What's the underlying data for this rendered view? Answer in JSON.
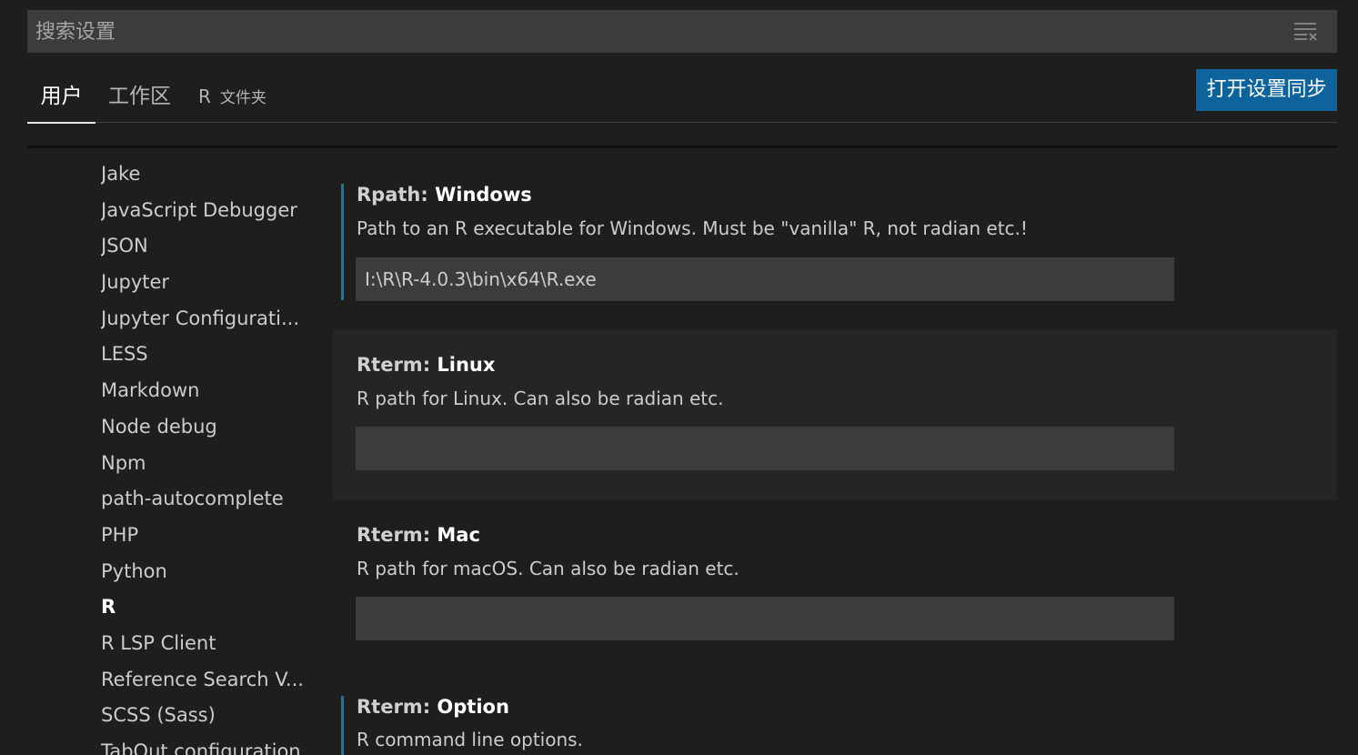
{
  "search": {
    "placeholder": "搜索设置",
    "filter_icon": "clear-filter-icon"
  },
  "tabs": {
    "user": "用户",
    "workspace": "工作区",
    "folder_prefix": "R",
    "folder_label": "文件夹",
    "active": "user"
  },
  "sync_button": "打开设置同步",
  "colors": {
    "background": "#1e1e1e",
    "accent_button": "#0e639c",
    "modified_indicator": "#0c7d9d",
    "input_background": "#3c3c3c"
  },
  "toc": {
    "items": [
      "Jake",
      "JavaScript Debugger",
      "JSON",
      "Jupyter",
      "Jupyter Configurati...",
      "LESS",
      "Markdown",
      "Node debug",
      "Npm",
      "path-autocomplete",
      "PHP",
      "Python",
      "R",
      "R LSP Client",
      "Reference Search V...",
      "SCSS (Sass)",
      "TabOut configuration"
    ],
    "active_index": 12
  },
  "settings": [
    {
      "category": "Rpath: ",
      "label": "Windows",
      "description": "Path to an R executable for Windows. Must be \"vanilla\" R, not radian etc.!",
      "value": "I:\\R\\R-4.0.3\\bin\\x64\\R.exe"
    },
    {
      "category": "Rterm: ",
      "label": "Linux",
      "description": "R path for Linux. Can also be radian etc.",
      "value": ""
    },
    {
      "category": "Rterm: ",
      "label": "Mac",
      "description": "R path for macOS. Can also be radian etc.",
      "value": ""
    },
    {
      "category": "Rterm: ",
      "label": "Option",
      "description": "R command line options."
    }
  ]
}
